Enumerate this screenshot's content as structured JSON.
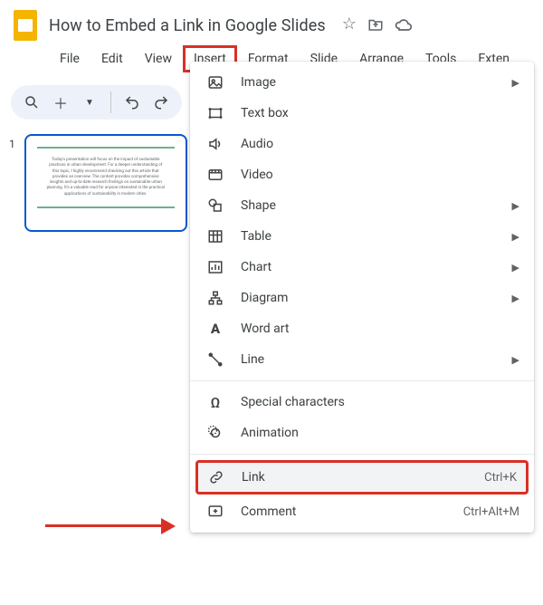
{
  "document": {
    "title": "How to Embed a Link in Google Slides"
  },
  "menubar": {
    "file": "File",
    "edit": "Edit",
    "view": "View",
    "insert": "Insert",
    "format": "Format",
    "slide": "Slide",
    "arrange": "Arrange",
    "tools": "Tools",
    "extensions": "Exten"
  },
  "slidepanel": {
    "slides": [
      {
        "number": "1"
      }
    ]
  },
  "insert_menu": {
    "image": "Image",
    "textbox": "Text box",
    "audio": "Audio",
    "video": "Video",
    "shape": "Shape",
    "table": "Table",
    "chart": "Chart",
    "diagram": "Diagram",
    "wordart": "Word art",
    "line": "Line",
    "special": "Special characters",
    "animation": "Animation",
    "link": "Link",
    "link_shortcut": "Ctrl+K",
    "comment": "Comment",
    "comment_shortcut": "Ctrl+Alt+M"
  }
}
